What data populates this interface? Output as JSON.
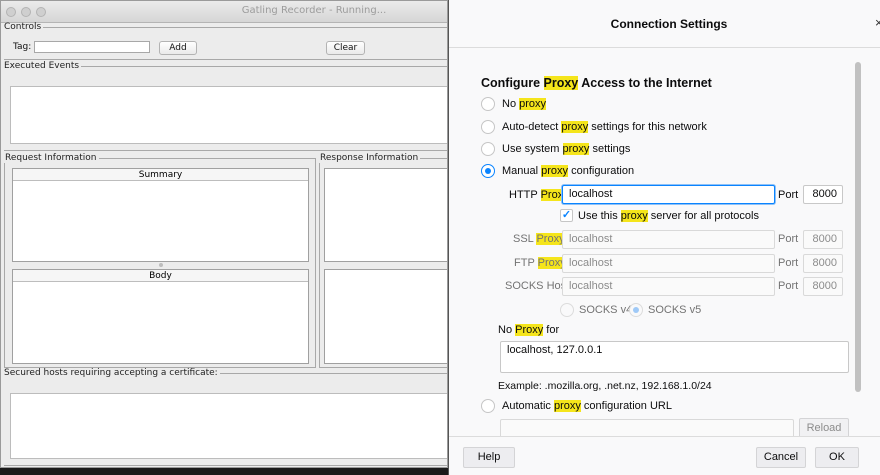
{
  "gatling": {
    "title": "Gatling Recorder - Running...",
    "controls": {
      "legend": "Controls",
      "tag_label": "Tag:",
      "tag_value": "",
      "add_label": "Add",
      "clear_label": "Clear"
    },
    "executed_events_legend": "Executed Events",
    "request_info": {
      "legend": "Request Information",
      "summary_label": "Summary",
      "body_label": "Body"
    },
    "response_info_legend": "Response Information",
    "secured_hosts_legend": "Secured hosts requiring accepting a certificate:"
  },
  "dialog": {
    "title": "Connection Settings",
    "close_glyph": "×",
    "heading": {
      "before": "Configure ",
      "highlight": "Proxy",
      "after": " Access to the Internet"
    },
    "options": [
      {
        "before": "No ",
        "highlight": "proxy",
        "after": "",
        "selected": false
      },
      {
        "before": "Auto-detect ",
        "highlight": "proxy",
        "after": " settings for this network",
        "selected": false
      },
      {
        "before": "Use system ",
        "highlight": "proxy",
        "after": " settings",
        "selected": false
      },
      {
        "before": "Manual ",
        "highlight": "proxy",
        "after": " configuration",
        "selected": true
      }
    ],
    "http": {
      "label_before": "HTTP ",
      "label_highlight": "Proxy",
      "value": "localhost",
      "port_label": "Port",
      "port": "8000"
    },
    "use_for_all": {
      "before": "Use this ",
      "highlight": "proxy",
      "after": " server for all protocols",
      "checked": true
    },
    "ssl": {
      "label_before": "SSL ",
      "label_highlight": "Proxy",
      "value": "localhost",
      "port_label": "Port",
      "port": "8000"
    },
    "ftp": {
      "label_before": "FTP ",
      "label_highlight": "Proxy",
      "value": "localhost",
      "port_label": "Port",
      "port": "8000"
    },
    "socks": {
      "label": "SOCKS Host",
      "value": "localhost",
      "port_label": "Port",
      "port": "8000"
    },
    "socks_v4": "SOCKS v4",
    "socks_v5": "SOCKS v5",
    "no_proxy": {
      "before": "No ",
      "highlight": "Proxy",
      "after": " for",
      "value": "localhost, 127.0.0.1"
    },
    "example": "Example: .mozilla.org, .net.nz, 192.168.1.0/24",
    "auto_config": {
      "before": "Automatic ",
      "highlight": "proxy",
      "after": " configuration URL",
      "value": ""
    },
    "reload_label": "Reload",
    "help_label": "Help",
    "cancel_label": "Cancel",
    "ok_label": "OK",
    "highlight_color": "#f5e51b",
    "accent_color": "#0a84ff"
  }
}
